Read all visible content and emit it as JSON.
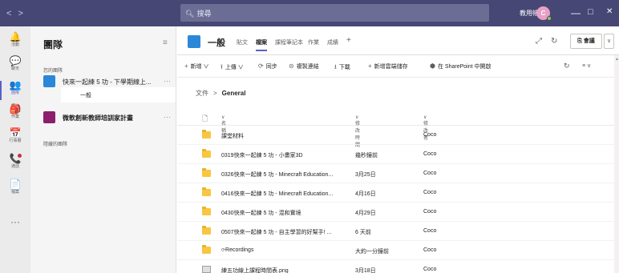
{
  "titlebar": {
    "search_placeholder": "搜尋",
    "user_name": "教用帳",
    "avatar_initial": "C",
    "nav_back": "<",
    "nav_forward": ">",
    "minimize": "—",
    "maximize": "□",
    "close": "✕"
  },
  "rail": [
    {
      "label": "活動",
      "icon": "bell-icon",
      "glyph": "🔔"
    },
    {
      "label": "聊天",
      "icon": "chat-icon",
      "glyph": "💬"
    },
    {
      "label": "團隊",
      "icon": "teams-icon",
      "glyph": "👥"
    },
    {
      "label": "作業",
      "icon": "assignments-icon",
      "glyph": "🎒"
    },
    {
      "label": "行事曆",
      "icon": "calendar-icon",
      "glyph": "📅"
    },
    {
      "label": "通話",
      "icon": "phone-icon",
      "glyph": "📞"
    },
    {
      "label": "檔案",
      "icon": "files-icon",
      "glyph": "📄"
    }
  ],
  "rail_more": "···",
  "teams_panel": {
    "title": "團隊",
    "section_yours": "您的團隊",
    "section_hidden": "隱藏的團隊",
    "teams": [
      {
        "name": "快來一起練 5 功 - 下學期線上...",
        "more": "···",
        "color": "#2b88d8"
      },
      {
        "name": "微軟創新教師培訓家計畫",
        "more": "···",
        "color": "#8b1f6b"
      }
    ],
    "channel": "一般"
  },
  "header": {
    "channel_title": "一般",
    "tabs": [
      "貼文",
      "檔案",
      "課程筆記本",
      "作業",
      "成績",
      "+"
    ],
    "active_tab": "檔案",
    "meet_label": "會議",
    "meet_dropdown": "∨"
  },
  "toolbar": {
    "new": "新增",
    "upload": "上傳",
    "sync": "同步",
    "copy_link": "複製連結",
    "download": "下載",
    "add_storage": "新增雲端儲存",
    "open_sharepoint": "在 SharePoint 中開啟"
  },
  "breadcrumb": {
    "root": "文件",
    "current": "General"
  },
  "columns": {
    "name": "名稱",
    "modified": "修改時間",
    "modified_by": "修改者"
  },
  "files": [
    {
      "name": "課堂材料",
      "modified": "",
      "by": "Coco",
      "type": "folder"
    },
    {
      "name": "0319快來一起練 5 功 - 小畫家3D",
      "modified": "幾秒鐘前",
      "by": "Coco",
      "type": "folder"
    },
    {
      "name": "0326快來一起練 5 功 - Minecraft Education...",
      "modified": "3月25日",
      "by": "Coco",
      "type": "folder"
    },
    {
      "name": "0416快來一起練 5 功 - Minecraft Education...",
      "modified": "4月16日",
      "by": "Coco",
      "type": "folder"
    },
    {
      "name": "0430快來一起練 5 功 - 混和實境",
      "modified": "4月29日",
      "by": "Coco",
      "type": "folder"
    },
    {
      "name": "0507快來一起練 5 功 - 自主學習的好幫手! ...",
      "modified": "6 天前",
      "by": "Coco",
      "type": "folder"
    },
    {
      "name": "Recordings",
      "modified": "大約一分鐘前",
      "by": "Coco",
      "type": "folder"
    },
    {
      "name": "練五功線上課程時間表.png",
      "modified": "3月18日",
      "by": "Coco",
      "type": "image"
    }
  ]
}
